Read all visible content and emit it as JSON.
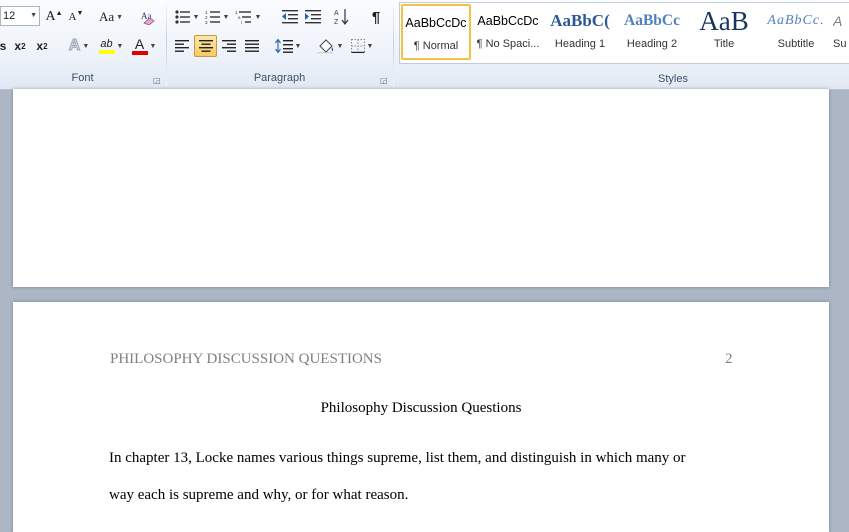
{
  "ribbon": {
    "font": {
      "label": "Font",
      "font_size": "12",
      "grow_label": "A",
      "shrink_label": "A",
      "change_case_label": "Aa",
      "subscript_label": "x",
      "subscript_sub": "2",
      "superscript_label": "x",
      "superscript_sup": "2",
      "text_effects_label": "A",
      "highlight_label": "ab",
      "font_color_label": "A",
      "bold_partial_label": "s",
      "highlight_color": "#ffff00",
      "font_color": "#e00000"
    },
    "paragraph": {
      "label": "Paragraph",
      "sort_label": "A↓Z",
      "pilcrow_label": "¶"
    },
    "styles": {
      "label": "Styles",
      "items": [
        {
          "sample": "AaBbCcDc",
          "name": "¶ Normal",
          "selected": true
        },
        {
          "sample": "AaBbCcDc",
          "name": "¶ No Spaci..."
        },
        {
          "sample": "AaBbC(",
          "name": "Heading 1"
        },
        {
          "sample": "AaBbCc",
          "name": "Heading 2"
        },
        {
          "sample": "AaB",
          "name": "Title"
        },
        {
          "sample": "AaBbCc.",
          "name": "Subtitle"
        },
        {
          "sample": "A",
          "name": "Su"
        }
      ]
    }
  },
  "document": {
    "header": "PHILOSOPHY DISCUSSION QUESTIONS",
    "page_number": "2",
    "title": "Philosophy Discussion Questions",
    "line1": "In chapter 13, Locke names various things supreme, list them, and distinguish in which many or",
    "line2": "way each is supreme and why, or for what reason."
  }
}
